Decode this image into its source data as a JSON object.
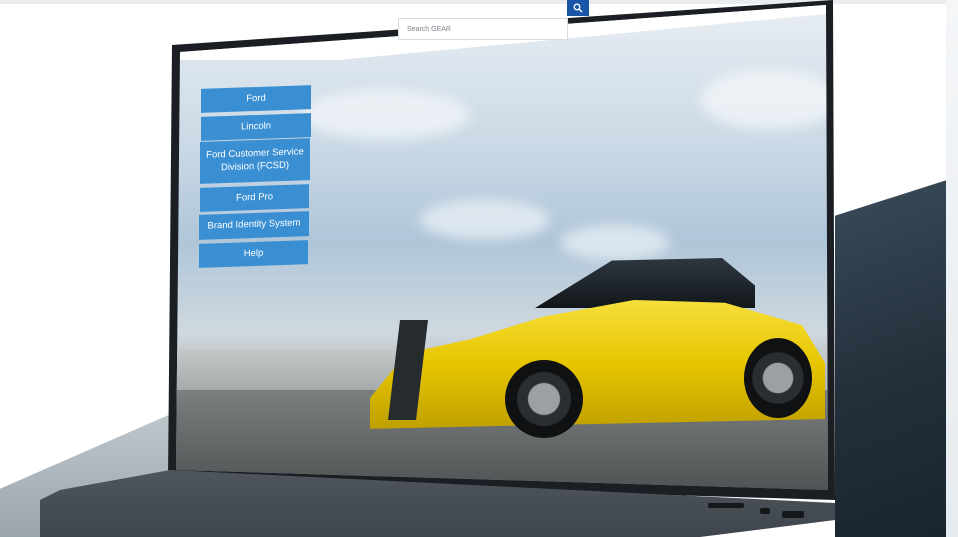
{
  "search": {
    "placeholder": "Search GEAR"
  },
  "nav_menu": {
    "items": [
      {
        "label": "Ford"
      },
      {
        "label": "Lincoln"
      },
      {
        "label": "Ford Customer Service Division (FCSD)"
      },
      {
        "label": "Ford Pro"
      },
      {
        "label": "Brand Identity System"
      },
      {
        "label": "Help"
      }
    ]
  },
  "colors": {
    "menu_button": "#3a8fd3",
    "search_button": "#1a56a8"
  },
  "icons": {
    "search": "magnifier-icon"
  }
}
